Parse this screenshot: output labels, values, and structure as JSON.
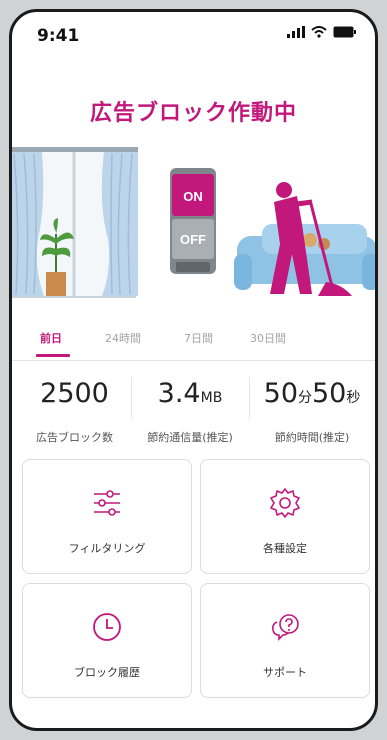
{
  "status_bar": {
    "time": "9:41",
    "icons": [
      "signal-icon",
      "wifi-icon",
      "battery-icon"
    ]
  },
  "header": {
    "title": "広告ブロック作動中"
  },
  "illustration": {
    "switch_on": "ON",
    "switch_off": "OFF"
  },
  "tabs": [
    {
      "label": "前日",
      "active": true
    },
    {
      "label": "24時間",
      "active": false
    },
    {
      "label": "7日間",
      "active": false
    },
    {
      "label": "30日間",
      "active": false
    }
  ],
  "stats": {
    "blocks": {
      "value": "2500",
      "label": "広告ブロック数"
    },
    "data_saved": {
      "value": "3.4",
      "unit": "MB",
      "label": "節約通信量(推定)"
    },
    "time_saved": {
      "minutes": "50",
      "min_unit": "分",
      "seconds": "50",
      "sec_unit": "秒",
      "label": "節約時間(推定)"
    }
  },
  "menu": {
    "filtering": {
      "label": "フィルタリング",
      "icon": "sliders-icon"
    },
    "settings": {
      "label": "各種設定",
      "icon": "gear-icon"
    },
    "history": {
      "label": "ブロック履歴",
      "icon": "clock-icon"
    },
    "support": {
      "label": "サポート",
      "icon": "chat-question-icon"
    }
  },
  "colors": {
    "accent": "#c2187b",
    "curtain": "#bcd5ea",
    "sofa": "#8fc3e6"
  }
}
